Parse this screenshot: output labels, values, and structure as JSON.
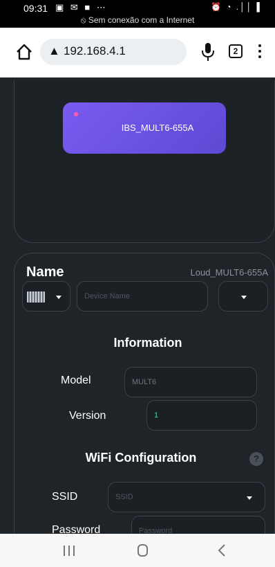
{
  "status_bar": {
    "time": "09:31",
    "notification_icons": "▣ ✉ ■ ⋯",
    "system_icons": "⏰ ◔ .││ ▌",
    "network_message": "⦸ Sem conexão com a Internet"
  },
  "browser": {
    "url_warning_icon": "▲",
    "url": "192.168.4.1",
    "tab_count": "2"
  },
  "device": {
    "name": "IBS_MULT6-655A",
    "status_color": "#ff5fa8"
  },
  "name_section": {
    "title": "Name",
    "current_name": "Loud_MULT6-655A",
    "icon": "film-icon",
    "placeholder": "Device Name"
  },
  "information": {
    "title": "Information",
    "model_label": "Model",
    "model_value": "MULT6",
    "version_label": "Version",
    "version_value": "1",
    "version_color": "#3ddc97"
  },
  "wifi": {
    "title": "WiFi Configuration",
    "help_icon": "?",
    "ssid_label": "SSID",
    "ssid_placeholder": "SSID",
    "password_label": "Password",
    "password_placeholder": "Password"
  },
  "colors": {
    "background": "#1f2429",
    "accent": "#6a52e3"
  }
}
